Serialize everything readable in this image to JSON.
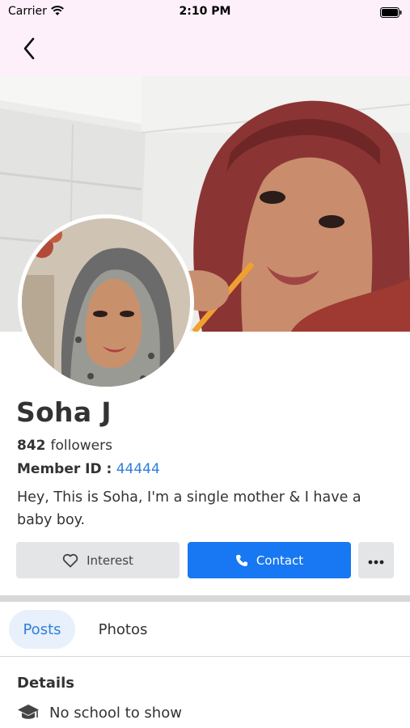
{
  "status_bar": {
    "carrier": "Carrier",
    "time": "2:10 PM"
  },
  "profile": {
    "name": "Soha J",
    "followers_count": "842",
    "followers_label": "followers",
    "member_id_label": "Member ID :",
    "member_id": "44444",
    "bio": "Hey, This is Soha, I'm a single mother & I have a baby boy."
  },
  "actions": {
    "interest_label": "Interest",
    "contact_label": "Contact",
    "more_label": "•••"
  },
  "tabs": [
    {
      "label": "Posts",
      "active": true
    },
    {
      "label": "Photos",
      "active": false
    }
  ],
  "details": {
    "title": "Details",
    "school_text": "No school to show"
  },
  "icons": {
    "back": "chevron-left-icon",
    "interest": "heart-outline-icon",
    "contact": "phone-icon",
    "more": "ellipsis-icon",
    "school": "graduation-cap-icon"
  },
  "colors": {
    "accent": "#1877f2",
    "link": "#2f7fdd",
    "nav_background": "#fdf0fa",
    "tab_active_background": "#e7f0fb"
  }
}
